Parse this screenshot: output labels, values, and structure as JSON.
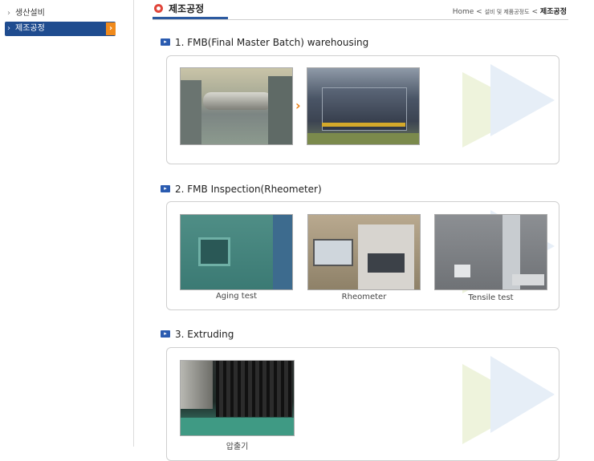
{
  "sidebar": {
    "items": [
      {
        "label": "생산설비"
      },
      {
        "label": "제조공정"
      }
    ]
  },
  "header": {
    "title": "제조공정",
    "breadcrumb": {
      "home": "Home",
      "sep1": "<",
      "mid": "설비 및 제품공정도",
      "sep2": "<",
      "current": "제조공정"
    }
  },
  "sections": [
    {
      "title": "1. FMB(Final Master Batch) warehousing"
    },
    {
      "title": "2. FMB Inspection(Rheometer)",
      "captions": [
        "Aging test",
        "Rheometer",
        "Tensile test"
      ]
    },
    {
      "title": "3. Extruding",
      "captions": [
        "압출기"
      ]
    }
  ],
  "colors": {
    "accent_blue": "#1f4c8f",
    "accent_orange": "#f08a1c",
    "head_icon": "#e0453a"
  }
}
